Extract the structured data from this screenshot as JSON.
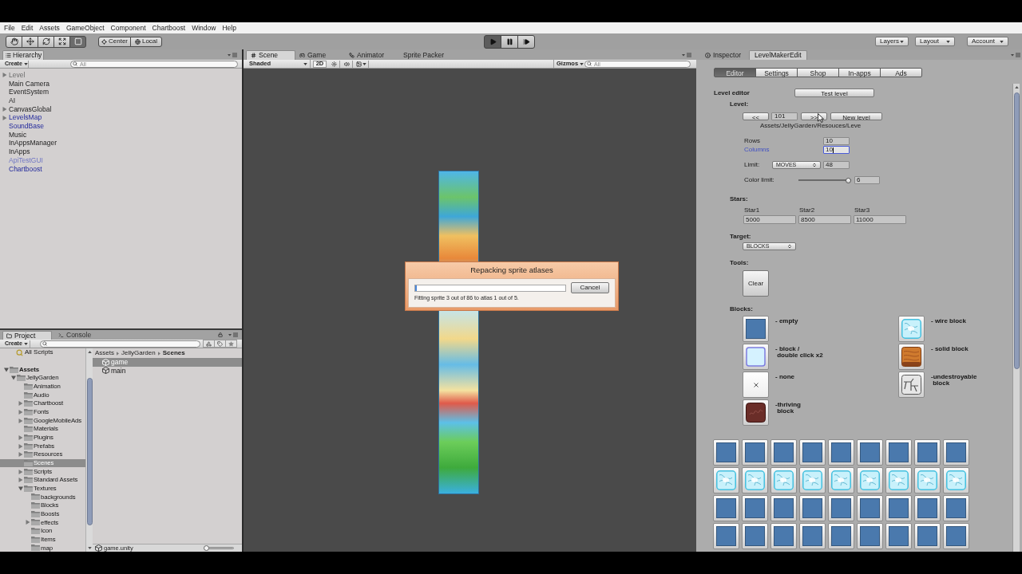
{
  "menu_bar": {
    "items": [
      "File",
      "Edit",
      "Assets",
      "GameObject",
      "Component",
      "Chartboost",
      "Window",
      "Help"
    ]
  },
  "toolbar": {
    "tools": [
      {
        "kind": "hand",
        "selected": false
      },
      {
        "kind": "move",
        "selected": false
      },
      {
        "kind": "rotate",
        "selected": false
      },
      {
        "kind": "scale",
        "selected": false
      },
      {
        "kind": "rect",
        "selected": true
      }
    ],
    "pivot": [
      {
        "kind": "center",
        "label": "Center"
      },
      {
        "kind": "local",
        "label": "Local"
      }
    ],
    "playback": [
      {
        "kind": "play",
        "selected": true
      },
      {
        "kind": "pause",
        "selected": false
      },
      {
        "kind": "step",
        "selected": false
      }
    ],
    "menus": [
      "Layers",
      "Layout",
      "Account"
    ]
  },
  "hierarchy": {
    "tab": "Hierarchy",
    "create": "Create",
    "search": {
      "placeholder": "All"
    },
    "items": [
      {
        "label": "Level",
        "kind": "inactive",
        "expanded": false,
        "selected": false
      },
      {
        "label": "Main Camera",
        "kind": "object",
        "selected": false
      },
      {
        "label": "EventSystem",
        "kind": "object",
        "selected": false
      },
      {
        "label": "AI",
        "kind": "object",
        "selected": false
      },
      {
        "label": "CanvasGlobal",
        "kind": "object",
        "expanded": false,
        "selected": false
      },
      {
        "label": "LevelsMap",
        "kind": "prefab",
        "expanded": false,
        "selected": false
      },
      {
        "label": "SoundBase",
        "kind": "prefab",
        "selected": false
      },
      {
        "label": "Music",
        "kind": "object",
        "selected": false
      },
      {
        "label": "InAppsManager",
        "kind": "object",
        "selected": false
      },
      {
        "label": "InApps",
        "kind": "object",
        "selected": false
      },
      {
        "label": "ApiTestGUI",
        "kind": "inactive_prefab",
        "selected": false
      },
      {
        "label": "Chartboost",
        "kind": "prefab",
        "selected": false
      }
    ]
  },
  "project": {
    "tabs": [
      {
        "kind": "project",
        "label": "Project",
        "selected": true
      },
      {
        "kind": "console",
        "label": "Console",
        "selected": false
      }
    ],
    "create": "Create",
    "favorites": [
      {
        "label": "All Scripts",
        "selected": false
      }
    ],
    "tree": [
      {
        "label": "Assets",
        "expanded": true,
        "selected": false,
        "children": [
          {
            "label": "JellyGarden",
            "expanded": true,
            "selected": false,
            "children": [
              {
                "label": "Animation",
                "selected": false
              },
              {
                "label": "Audio",
                "selected": false
              },
              {
                "label": "Chartboost",
                "expanded": false,
                "selected": false
              },
              {
                "label": "Fonts",
                "expanded": false,
                "selected": false
              },
              {
                "label": "GoogleMobileAds",
                "expanded": false,
                "selected": false
              },
              {
                "label": "Materials",
                "selected": false
              },
              {
                "label": "Plugins",
                "expanded": false,
                "selected": false
              },
              {
                "label": "Prefabs",
                "expanded": false,
                "selected": false
              },
              {
                "label": "Resources",
                "expanded": false,
                "selected": false
              },
              {
                "label": "Scenes",
                "selected": true
              },
              {
                "label": "Scripts",
                "expanded": false,
                "selected": false
              },
              {
                "label": "Standard Assets",
                "expanded": false,
                "selected": false
              },
              {
                "label": "Textures",
                "expanded": true,
                "selected": false,
                "children": [
                  {
                    "label": "backgrounds",
                    "selected": false
                  },
                  {
                    "label": "Blocks",
                    "selected": false
                  },
                  {
                    "label": "Boosts",
                    "selected": false
                  },
                  {
                    "label": "effects",
                    "expanded": false,
                    "selected": false
                  },
                  {
                    "label": "Icon",
                    "selected": false
                  },
                  {
                    "label": "Items",
                    "selected": false
                  },
                  {
                    "label": "map",
                    "selected": false
                  }
                ]
              }
            ]
          }
        ]
      }
    ],
    "breadcrumb": [
      "Assets",
      "JellyGarden",
      "Scenes"
    ],
    "files": [
      {
        "label": "game",
        "selected": true
      },
      {
        "label": "main",
        "selected": false
      }
    ],
    "footer": {
      "path": "game.unity",
      "zoom": {
        "level": 0
      }
    }
  },
  "scene": {
    "tabs": [
      {
        "kind": "scene",
        "label": "Scene",
        "selected": true
      },
      {
        "kind": "game",
        "label": "Game",
        "selected": false
      },
      {
        "kind": "animator",
        "label": "Animator",
        "selected": false
      },
      {
        "kind": "sprite_packer",
        "label": "Sprite Packer",
        "selected": false
      }
    ],
    "shading": "Shaded",
    "mode_2d": "2D",
    "gizmos": "Gizmos",
    "search": {
      "placeholder": "All"
    },
    "dialog": {
      "title": "Repacking sprite atlases",
      "progress": {
        "level": 0.01
      },
      "cancel": "Cancel",
      "message": "Fitting sprite 3 out of 86 to atlas 1 out of 5."
    }
  },
  "inspector": {
    "tabs": [
      {
        "kind": "inspector",
        "label": "Inspector",
        "selected": false
      },
      {
        "kind": "editor",
        "label": "LevelMakerEdit",
        "selected": true
      }
    ],
    "sections": [
      {
        "label": "Editor",
        "selected": true
      },
      {
        "label": "Settings",
        "selected": false
      },
      {
        "label": "Shop",
        "selected": false
      },
      {
        "label": "In-apps",
        "selected": false
      },
      {
        "label": "Ads",
        "selected": false
      }
    ],
    "title": "Level editor",
    "test_button": "Test level",
    "level": {
      "label": "Level:",
      "prev": "<<",
      "number": "101",
      "next": ">>",
      "new": "New level",
      "path": "Assets/JellyGarden/Resouces/Leve"
    },
    "size_fields": [
      {
        "label": "Rows",
        "value": "10",
        "focused": false
      },
      {
        "label": "Columns",
        "value": "10",
        "focused": true
      }
    ],
    "limit": {
      "label": "Limit:",
      "mode": "MOVES",
      "value": "48"
    },
    "color_limit": {
      "label": "Color limit:",
      "level": 1,
      "value": "6"
    },
    "stars": {
      "label": "Stars:",
      "items": [
        {
          "label": "Star1",
          "value": "5000"
        },
        {
          "label": "Star2",
          "value": "8500"
        },
        {
          "label": "Star3",
          "value": "11000"
        }
      ]
    },
    "target": {
      "label": "Target:",
      "value": "BLOCKS"
    },
    "tools": {
      "label": "Tools:",
      "clear": "Clear"
    },
    "blocks": {
      "label": "Blocks:",
      "legend": [
        {
          "kind": "empty",
          "label": "- empty"
        },
        {
          "kind": "wire",
          "label": "- wire block"
        },
        {
          "kind": "block",
          "label": "- block /\n double click x2"
        },
        {
          "kind": "solid",
          "label": "- solid block"
        },
        {
          "kind": "none",
          "label": "- none"
        },
        {
          "kind": "undestroyable",
          "label": "-undestroyable\n block"
        },
        {
          "kind": "thriving",
          "label": "-thriving\n block"
        }
      ]
    },
    "grid": [
      {
        "cells": [
          {
            "kind": "empty"
          },
          {
            "kind": "empty"
          },
          {
            "kind": "empty"
          },
          {
            "kind": "empty"
          },
          {
            "kind": "empty"
          },
          {
            "kind": "empty"
          },
          {
            "kind": "empty"
          },
          {
            "kind": "empty"
          },
          {
            "kind": "empty"
          }
        ]
      },
      {
        "cells": [
          {
            "kind": "wire"
          },
          {
            "kind": "wire"
          },
          {
            "kind": "wire"
          },
          {
            "kind": "wire"
          },
          {
            "kind": "wire"
          },
          {
            "kind": "wire"
          },
          {
            "kind": "wire"
          },
          {
            "kind": "wire"
          },
          {
            "kind": "wire"
          }
        ]
      },
      {
        "cells": [
          {
            "kind": "empty"
          },
          {
            "kind": "empty"
          },
          {
            "kind": "empty"
          },
          {
            "kind": "empty"
          },
          {
            "kind": "empty"
          },
          {
            "kind": "empty"
          },
          {
            "kind": "empty"
          },
          {
            "kind": "empty"
          },
          {
            "kind": "empty"
          }
        ]
      },
      {
        "cells": [
          {
            "kind": "empty"
          },
          {
            "kind": "empty"
          },
          {
            "kind": "empty"
          },
          {
            "kind": "empty"
          },
          {
            "kind": "empty"
          },
          {
            "kind": "empty"
          },
          {
            "kind": "empty"
          },
          {
            "kind": "empty"
          },
          {
            "kind": "empty"
          }
        ]
      }
    ]
  }
}
